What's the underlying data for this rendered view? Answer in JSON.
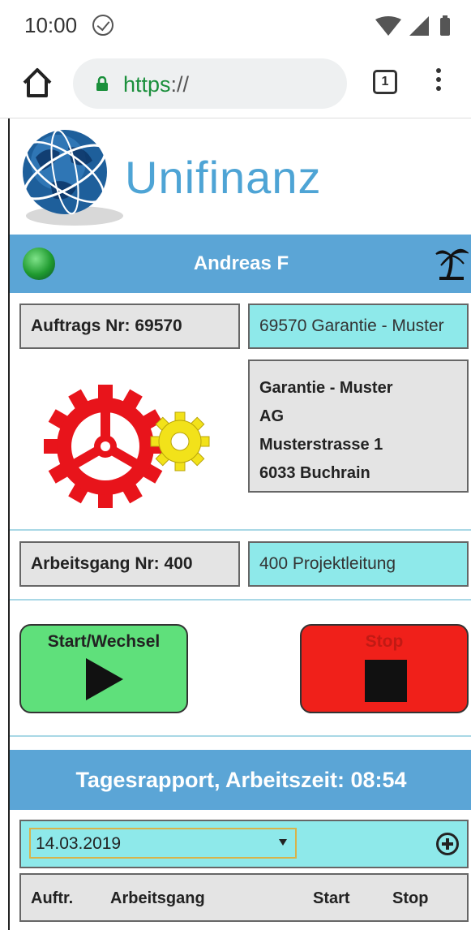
{
  "status_bar": {
    "time": "10:00",
    "icons": [
      "check-circle-icon",
      "wifi-icon",
      "signal-icon",
      "battery-icon"
    ]
  },
  "browser": {
    "url_scheme": "https",
    "url_rest": "://",
    "tab_count": "1",
    "icons": [
      "home-icon",
      "lock-icon",
      "tabs-icon",
      "more-vert-icon"
    ]
  },
  "header": {
    "brand": "Unifinanz",
    "logo_icon": "globe-icon"
  },
  "user_bar": {
    "name": "Andreas F",
    "status_icon": "green-status-led-icon",
    "vacation_icon": "palm-tree-icon"
  },
  "order": {
    "label": "Auftrags Nr: 69570",
    "value": "69570 Garantie - Muster",
    "address": [
      "Garantie - Muster",
      "AG",
      "Musterstrasse 1",
      "6033 Buchrain"
    ],
    "illustration": "gears-icon"
  },
  "operation": {
    "label": "Arbeitsgang Nr: 400",
    "value": "400 Projektleitung"
  },
  "actions": {
    "start_label": "Start/Wechsel",
    "stop_label": "Stop"
  },
  "daily_report": {
    "title": "Tagesrapport, Arbeitszeit: 08:54",
    "date": "14.03.2019",
    "columns": [
      "Auftr.",
      "Arbeitsgang",
      "Start",
      "Stop"
    ]
  },
  "colors": {
    "header_blue": "#5ba5d6",
    "field_cyan": "#8ee9ea",
    "field_grey": "#e4e4e4",
    "start_green": "#5fe07b",
    "stop_red": "#f0201a",
    "brand_blue": "#4ea4d5"
  }
}
